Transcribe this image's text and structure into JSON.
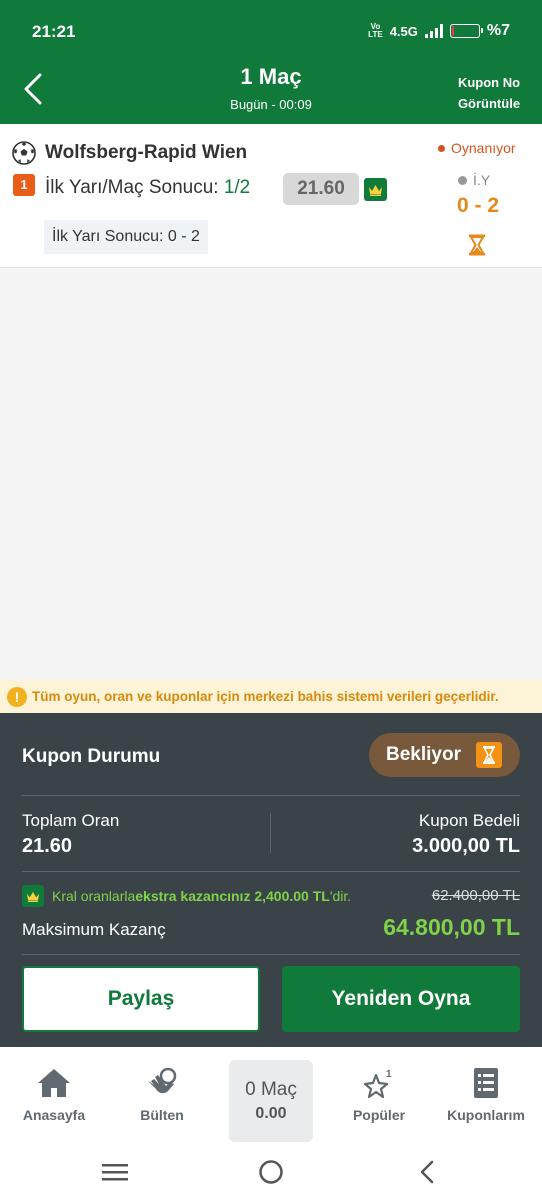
{
  "status_bar": {
    "time": "21:21",
    "network": "4.5G",
    "volte": "VoLTE",
    "battery_pct": "%7",
    "battery_level": 0.07
  },
  "header": {
    "title": "1 Maç",
    "subtitle": "Bugün - 00:09",
    "kupon_no_label": "Kupon No Görüntüle"
  },
  "match": {
    "title": "Wolfsberg-Rapid Wien",
    "status": "Oynanıyor",
    "index": "1",
    "bet_label": "İlk Yarı/Maç Sonucu: ",
    "pick": "1/2",
    "odd": "21.60",
    "period": "İ.Y",
    "score": "0 - 2",
    "ht_result": "İlk Yarı Sonucu: 0 - 2"
  },
  "info_banner": {
    "text": "Tüm oyun, oran ve kuponlar için merkezi bahis sistemi verileri geçerlidir."
  },
  "coupon": {
    "title": "Kupon Durumu",
    "status": "Bekliyor",
    "total_odd_label": "Toplam Oran",
    "total_odd": "21.60",
    "stake_label": "Kupon Bedeli",
    "stake": "3.000,00 TL",
    "king_text_1": "Kral oranlarla ",
    "king_text_2": "ekstra kazancınız 2,400.00 TL",
    "king_text_3": "'dir.",
    "old_win": "62.400,00 TL",
    "max_label": "Maksimum Kazanç",
    "max_win": "64.800,00 TL",
    "share_label": "Paylaş",
    "replay_label": "Yeniden Oyna"
  },
  "bottom_nav": {
    "home": "Anasayfa",
    "bulletin": "Bülten",
    "coupon_count": "0 Maç",
    "coupon_amount": "0.00",
    "popular": "Popüler",
    "popular_badge": "1",
    "my_coupons": "Kuponlarım"
  },
  "colors": {
    "brand_green": "#0f7a3a",
    "live_orange": "#d3541e",
    "score_orange": "#e8891d",
    "panel_dark": "#3a4347",
    "highlight_green": "#7fd24a"
  }
}
